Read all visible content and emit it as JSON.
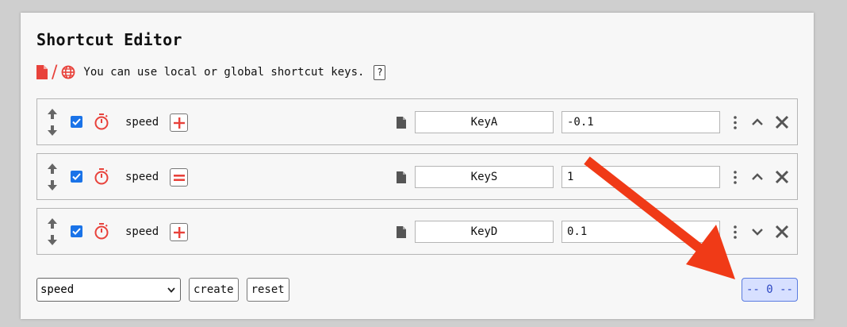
{
  "header": {
    "title": "Shortcut Editor",
    "separator": "/",
    "description": "You can use local or global shortcut keys.",
    "help_label": "?"
  },
  "rows": [
    {
      "enabled": true,
      "command": "speed",
      "operator": "+",
      "key": "KeyA",
      "value": "-0.1",
      "toggle": "chevron-up-icon"
    },
    {
      "enabled": true,
      "command": "speed",
      "operator": "=",
      "key": "KeyS",
      "value": "1",
      "toggle": "chevron-up-icon"
    },
    {
      "enabled": true,
      "command": "speed",
      "operator": "+",
      "key": "KeyD",
      "value": "0.1",
      "toggle": "chevron-down-icon"
    }
  ],
  "footer": {
    "select_value": "speed",
    "create_label": "create",
    "reset_label": "reset",
    "counter_label": "-- 0 --"
  },
  "colors": {
    "accent_red": "#e8423b",
    "checkbox_blue": "#1a73e8",
    "counter_bg": "#d7e0ff",
    "counter_text": "#2b46c2",
    "annotation_arrow": "#f03a17"
  }
}
